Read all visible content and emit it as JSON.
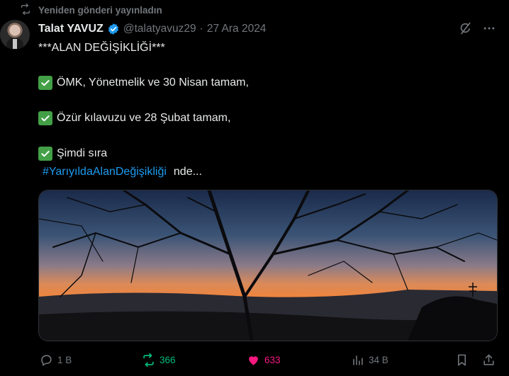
{
  "repost_banner": {
    "text": "Yeniden gönderi yayınladın",
    "icon": "repost-icon"
  },
  "post": {
    "author_name": "Talat YAVUZ",
    "verified": true,
    "handle": "@talatyavuz29",
    "separator": "·",
    "date": "27 Ara 2024",
    "lines": {
      "l1": "***ALAN DEĞİŞİKLİĞİ***",
      "l2": "ÖMK, Yönetmelik ve 30 Nisan tamam,",
      "l3": "Özür kılavuzu ve 28 Şubat tamam,",
      "l4": "Şimdi sıra",
      "hashtag": "#YarıyıldaAlanDeğişikliği",
      "l5_tail": "nde..."
    },
    "media": {
      "alt": "Sunset sky behind bare tree branches"
    }
  },
  "actions": {
    "replies": "1 B",
    "reposts": "366",
    "likes": "633",
    "views": "34 B"
  },
  "colors": {
    "background": "#000000",
    "text": "#e7e9ea",
    "muted": "#71767b",
    "link": "#1d9bf0",
    "repost_active": "#00ba7c",
    "like_active": "#f91880",
    "check_emoji": "#43a047"
  }
}
